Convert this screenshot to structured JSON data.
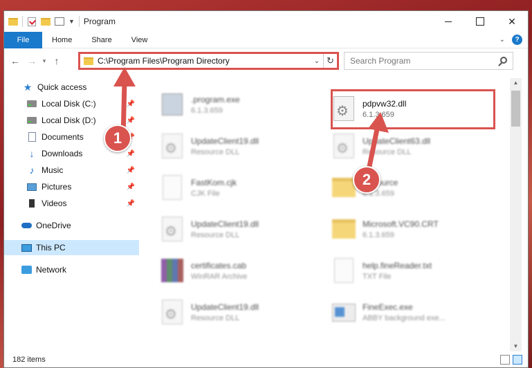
{
  "window": {
    "title": "Program"
  },
  "ribbon": {
    "tabs": [
      "File",
      "Home",
      "Share",
      "View"
    ]
  },
  "address": {
    "path": "C:\\Program Files\\Program Directory"
  },
  "search": {
    "placeholder": "Search Program"
  },
  "sidebar": {
    "items": [
      {
        "label": "Quick access",
        "icon": "star-icon",
        "pinned": false
      },
      {
        "label": "Local Disk (C:)",
        "icon": "disk-icon",
        "pinned": true
      },
      {
        "label": "Local Disk (D:)",
        "icon": "disk-icon",
        "pinned": true
      },
      {
        "label": "Documents",
        "icon": "documents-icon",
        "pinned": true
      },
      {
        "label": "Downloads",
        "icon": "download-icon",
        "pinned": true
      },
      {
        "label": "Music",
        "icon": "music-icon",
        "pinned": true
      },
      {
        "label": "Pictures",
        "icon": "pictures-icon",
        "pinned": true
      },
      {
        "label": "Videos",
        "icon": "videos-icon",
        "pinned": true
      },
      {
        "label": "OneDrive",
        "icon": "cloud-icon",
        "pinned": false
      },
      {
        "label": "This PC",
        "icon": "pc-icon",
        "pinned": false,
        "selected": true
      },
      {
        "label": "Network",
        "icon": "network-icon",
        "pinned": false
      }
    ]
  },
  "files": [
    {
      "name": ".program.exe",
      "type": "6.1.3.659",
      "icon": "setup-icon"
    },
    {
      "name": "pdpvw32.dll",
      "type": "6.1.3.659",
      "icon": "dll-file-icon",
      "highlighted": true
    },
    {
      "name": "UpdateClient19.dll",
      "type": "Resource DLL",
      "icon": "dll-file-icon"
    },
    {
      "name": "UpdateClient63.dll",
      "type": "Resource DLL",
      "icon": "dll-file-icon"
    },
    {
      "name": "FastKom.cjk",
      "type": "CJK File",
      "icon": "blank-file-icon"
    },
    {
      "name": "Resource",
      "type": "6.1.3.659",
      "icon": "folder-icon"
    },
    {
      "name": "UpdateClient19.dll",
      "type": "Resource DLL",
      "icon": "dll-file-icon"
    },
    {
      "name": "Microsoft.VC90.CRT",
      "type": "6.1.3.659",
      "icon": "folder-icon"
    },
    {
      "name": "certificates.cab",
      "type": "WinRAR Archive",
      "icon": "archive-icon"
    },
    {
      "name": "help.fineReader.txt",
      "type": "TXT File",
      "icon": "blank-file-icon"
    },
    {
      "name": "UpdateClient19.dll",
      "type": "Resource DLL",
      "icon": "dll-file-icon"
    },
    {
      "name": "FineExec.exe",
      "type": "ABBY background exe...",
      "icon": "exe-icon"
    }
  ],
  "status": {
    "count": "182 items"
  },
  "annotations": {
    "step1": "1",
    "step2": "2",
    "color": "#d9534f"
  }
}
